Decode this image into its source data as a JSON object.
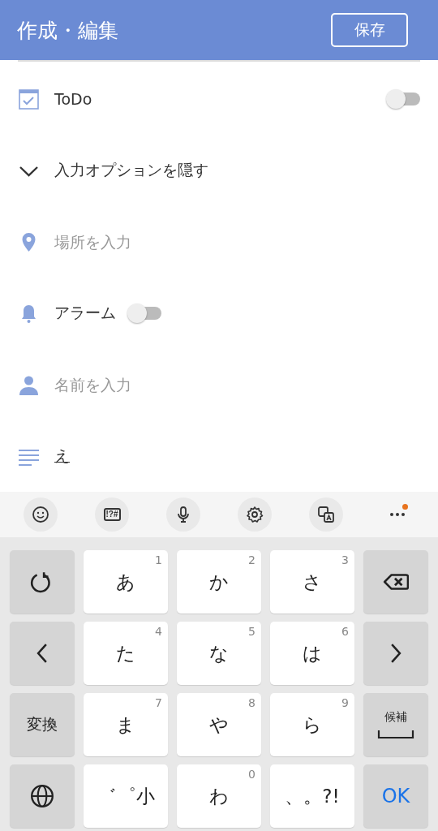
{
  "header": {
    "title": "作成・編集",
    "save_button": "保存"
  },
  "rows": [
    {
      "kind": "toggle",
      "label": "ToDo",
      "on": false
    },
    {
      "kind": "expander",
      "label": "入力オプションを隠す",
      "expanded": true
    },
    {
      "kind": "input",
      "placeholder": "場所を入力"
    },
    {
      "kind": "toggle",
      "label": "アラーム",
      "on": false
    },
    {
      "kind": "input",
      "placeholder": "名前を入力"
    },
    {
      "kind": "memo",
      "value": "え"
    }
  ],
  "keyboard_toolbar": [
    {
      "kind": "emoji"
    },
    {
      "kind": "symbols",
      "label": "!?#"
    },
    {
      "kind": "mic"
    },
    {
      "kind": "settings"
    },
    {
      "kind": "translate"
    },
    {
      "kind": "more",
      "badge": true
    }
  ],
  "keys": [
    {
      "kind": "icon"
    },
    {
      "kind": "char",
      "label": "あ",
      "digit": "1"
    },
    {
      "kind": "char",
      "label": "か",
      "digit": "2"
    },
    {
      "kind": "char",
      "label": "さ",
      "digit": "3"
    },
    {
      "kind": "icon"
    },
    {
      "kind": "icon"
    },
    {
      "kind": "char",
      "label": "た",
      "digit": "4"
    },
    {
      "kind": "char",
      "label": "な",
      "digit": "5"
    },
    {
      "kind": "char",
      "label": "は",
      "digit": "6"
    },
    {
      "kind": "icon"
    },
    {
      "kind": "text",
      "label": "変換"
    },
    {
      "kind": "char",
      "label": "ま",
      "digit": "7"
    },
    {
      "kind": "char",
      "label": "や",
      "digit": "8"
    },
    {
      "kind": "char",
      "label": "ら",
      "digit": "9"
    },
    {
      "kind": "space",
      "label": "候補"
    },
    {
      "kind": "icon"
    },
    {
      "kind": "char",
      "label": "゛゜小"
    },
    {
      "kind": "char",
      "label": "わ",
      "digit": "0"
    },
    {
      "kind": "char",
      "label": "、。?!"
    },
    {
      "kind": "ok",
      "label": "OK"
    }
  ]
}
